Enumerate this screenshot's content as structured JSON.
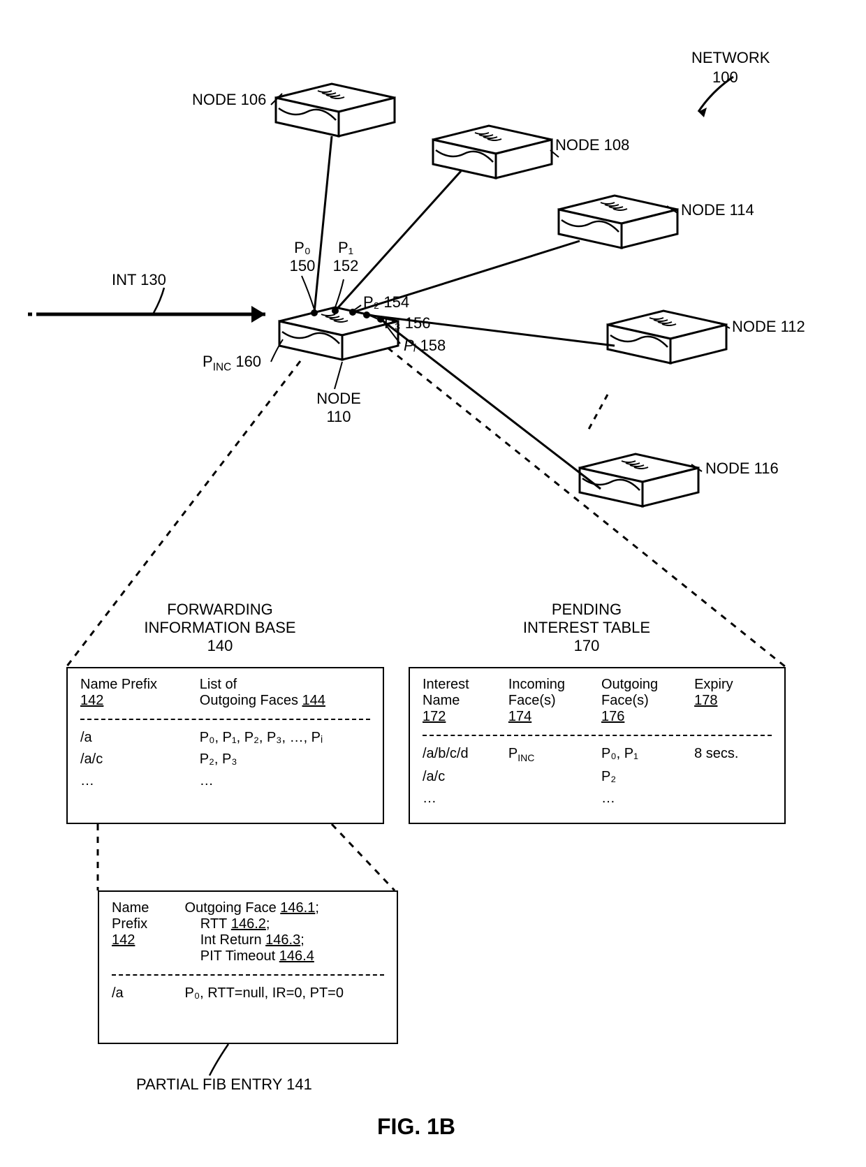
{
  "network": {
    "title": "NETWORK",
    "id": "100"
  },
  "nodes": {
    "n106": "NODE 106",
    "n108": "NODE 108",
    "n114": "NODE 114",
    "n112": "NODE 112",
    "n116": "NODE 116",
    "n110_label": "NODE",
    "n110_id": "110"
  },
  "interest": {
    "label": "INT 130"
  },
  "ports": {
    "p0_label": "P₀",
    "p0_id": "150",
    "p1_label": "P₁",
    "p1_id": "152",
    "p2_label": "P₂",
    "p2_id": "154",
    "p3_label": "P₃",
    "p3_id": "156",
    "pi_label": "Pᵢ",
    "pi_id": "158",
    "pinc_base": "P",
    "pinc_sub": "INC",
    "pinc_id": "160"
  },
  "fib": {
    "title_l1": "FORWARDING",
    "title_l2": "INFORMATION BASE",
    "title_id": "140",
    "col1_l1": "Name Prefix",
    "col1_id": "142",
    "col2_l1": "List of",
    "col2_l2": "Outgoing Faces",
    "col2_id": "144",
    "rows": [
      {
        "prefix": "/a",
        "faces": "P₀, P₁, P₂, P₃, …, Pᵢ"
      },
      {
        "prefix": "/a/c",
        "faces": "P₂, P₃"
      },
      {
        "prefix": "…",
        "faces": "…"
      }
    ]
  },
  "pit": {
    "title_l1": "PENDING",
    "title_l2": "INTEREST TABLE",
    "title_id": "170",
    "col1_l1": "Interest",
    "col1_l2": "Name",
    "col1_id": "172",
    "col2_l1": "Incoming",
    "col2_l2": "Face(s)",
    "col2_id": "174",
    "col3_l1": "Outgoing",
    "col3_l2": "Face(s)",
    "col3_id": "176",
    "col4_l1": "Expiry",
    "col4_id": "178",
    "rows": [
      {
        "name": "/a/b/c/d",
        "in": "PINC",
        "out": "P₀, P₁",
        "exp": "8 secs."
      },
      {
        "name": "/a/c",
        "in": "",
        "out": "P₂",
        "exp": ""
      },
      {
        "name": "…",
        "in": "",
        "out": "…",
        "exp": ""
      }
    ]
  },
  "partial_fib": {
    "title": "PARTIAL FIB ENTRY 141",
    "col_name_l1": "Name",
    "col_name_l2": "Prefix",
    "col_name_id": "142",
    "outface_label": "Outgoing Face",
    "outface_id": "146.1",
    "rtt_label": "RTT",
    "rtt_id": "146.2",
    "intret_label": "Int Return",
    "intret_id": "146.3",
    "pittimeout_label": "PIT Timeout",
    "pittimeout_id": "146.4",
    "row_prefix": "/a",
    "row_values": "P₀, RTT=null, IR=0, PT=0"
  },
  "figure": {
    "title": "FIG. 1B"
  }
}
